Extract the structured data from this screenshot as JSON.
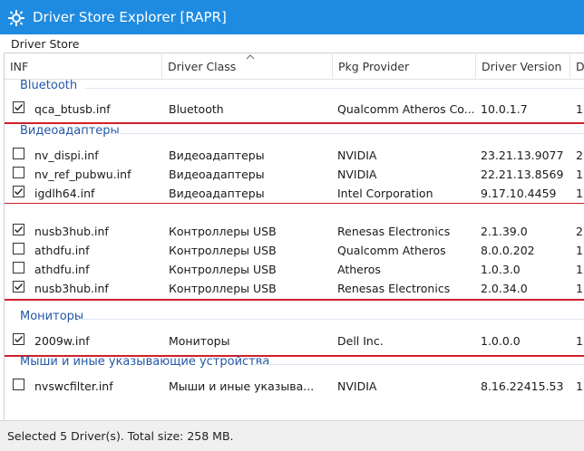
{
  "window": {
    "title": "Driver Store Explorer [RAPR]"
  },
  "group_label": "Driver Store",
  "columns": [
    "INF",
    "Driver Class",
    "Pkg Provider",
    "Driver Version",
    "D"
  ],
  "groups": [
    {
      "name": "Bluetooth",
      "rows": [
        {
          "checked": true,
          "inf": "qca_btusb.inf",
          "class": "Bluetooth",
          "provider": "Qualcomm Atheros Co...",
          "version": "10.0.1.7",
          "extra": "1"
        }
      ]
    },
    {
      "name": "Видеоадаптеры",
      "rows": [
        {
          "checked": false,
          "inf": "nv_dispi.inf",
          "class": "Видеоадаптеры",
          "provider": "NVIDIA",
          "version": "23.21.13.9077",
          "extra": "2"
        },
        {
          "checked": false,
          "inf": "nv_ref_pubwu.inf",
          "class": "Видеоадаптеры",
          "provider": "NVIDIA",
          "version": "22.21.13.8569",
          "extra": "1"
        },
        {
          "checked": true,
          "inf": "igdlh64.inf",
          "class": "Видеоадаптеры",
          "provider": "Intel Corporation",
          "version": "9.17.10.4459",
          "extra": "1"
        }
      ]
    },
    {
      "name": "",
      "rows": [
        {
          "checked": true,
          "inf": "nusb3hub.inf",
          "class": "Контроллеры USB",
          "provider": "Renesas Electronics",
          "version": "2.1.39.0",
          "extra": "2"
        },
        {
          "checked": false,
          "inf": "athdfu.inf",
          "class": "Контроллеры USB",
          "provider": "Qualcomm Atheros",
          "version": "8.0.0.202",
          "extra": "1"
        },
        {
          "checked": false,
          "inf": "athdfu.inf",
          "class": "Контроллеры USB",
          "provider": "Atheros",
          "version": "1.0.3.0",
          "extra": "1"
        },
        {
          "checked": true,
          "inf": "nusb3hub.inf",
          "class": "Контроллеры USB",
          "provider": "Renesas Electronics",
          "version": "2.0.34.0",
          "extra": "1"
        }
      ]
    },
    {
      "name": "Мониторы",
      "rows": [
        {
          "checked": true,
          "inf": "2009w.inf",
          "class": "Мониторы",
          "provider": "Dell Inc.",
          "version": "1.0.0.0",
          "extra": "1"
        }
      ]
    },
    {
      "name": "Мыши и иные указывающие устройства",
      "rows": [
        {
          "checked": false,
          "inf": "nvswcfilter.inf",
          "class": "Мыши и иные указыва...",
          "provider": "NVIDIA",
          "version": "8.16.22415.53",
          "extra": "1"
        }
      ]
    }
  ],
  "status": "Selected 5 Driver(s). Total size: 258 MB.",
  "colors": {
    "titlebar": "#1f8be0",
    "group_text": "#2457a8",
    "highlight_line": "#d0202a"
  }
}
